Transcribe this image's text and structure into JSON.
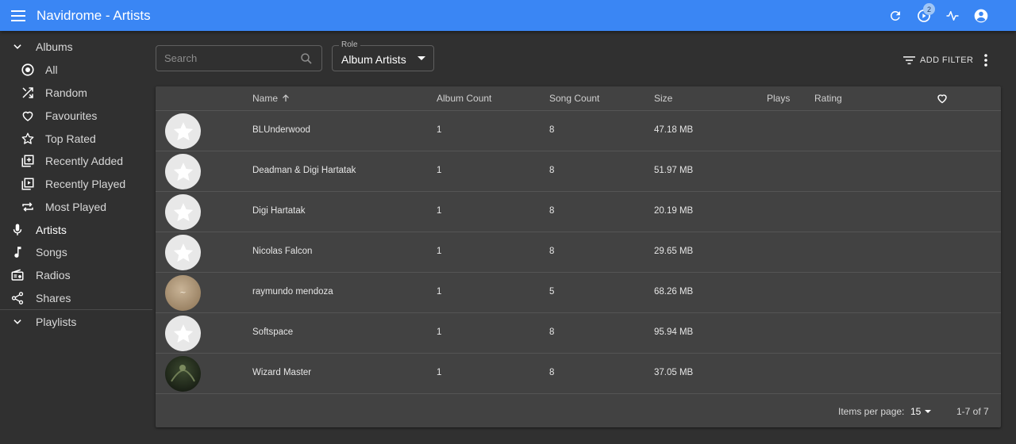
{
  "appbar": {
    "title": "Navidrome - Artists",
    "color": "#3a86f4",
    "icons": [
      "menu-icon",
      "refresh-icon",
      "play-queue-icon",
      "activity-icon",
      "account-icon"
    ],
    "queue_badge": "2"
  },
  "sidebar": {
    "albums_label": "Albums",
    "album_items": [
      {
        "label": "All",
        "icon": "all-icon"
      },
      {
        "label": "Random",
        "icon": "shuffle-icon"
      },
      {
        "label": "Favourites",
        "icon": "heart-icon"
      },
      {
        "label": "Top Rated",
        "icon": "star-icon"
      },
      {
        "label": "Recently Added",
        "icon": "library-add-icon"
      },
      {
        "label": "Recently Played",
        "icon": "video-library-icon"
      },
      {
        "label": "Most Played",
        "icon": "repeat-icon"
      }
    ],
    "main_items": [
      {
        "label": "Artists",
        "icon": "mic-icon"
      },
      {
        "label": "Songs",
        "icon": "music-note-icon"
      },
      {
        "label": "Radios",
        "icon": "radio-icon"
      },
      {
        "label": "Shares",
        "icon": "share-icon"
      }
    ],
    "playlists_label": "Playlists"
  },
  "toolbar": {
    "search_placeholder": "Search",
    "role_label": "Role",
    "role_value": "Album Artists",
    "add_filter_label": "ADD FILTER"
  },
  "table": {
    "columns": {
      "name": "Name",
      "album_count": "Album Count",
      "song_count": "Song Count",
      "size": "Size",
      "plays": "Plays",
      "rating": "Rating"
    },
    "rows": [
      {
        "name": "BLUnderwood",
        "album_count": "1",
        "song_count": "8",
        "size": "47.18 MB"
      },
      {
        "name": "Deadman & Digi Hartatak",
        "album_count": "1",
        "song_count": "8",
        "size": "51.97 MB"
      },
      {
        "name": "Digi Hartatak",
        "album_count": "1",
        "song_count": "8",
        "size": "20.19 MB"
      },
      {
        "name": "Nicolas Falcon",
        "album_count": "1",
        "song_count": "8",
        "size": "29.65 MB"
      },
      {
        "name": "raymundo mendoza",
        "album_count": "1",
        "song_count": "5",
        "size": "68.26 MB"
      },
      {
        "name": "Softspace",
        "album_count": "1",
        "song_count": "8",
        "size": "95.94 MB"
      },
      {
        "name": "Wizard Master",
        "album_count": "1",
        "song_count": "8",
        "size": "37.05 MB"
      }
    ],
    "footer": {
      "items_per_page_label": "Items per page:",
      "items_per_page_value": "15",
      "range": "1-7 of 7"
    }
  }
}
